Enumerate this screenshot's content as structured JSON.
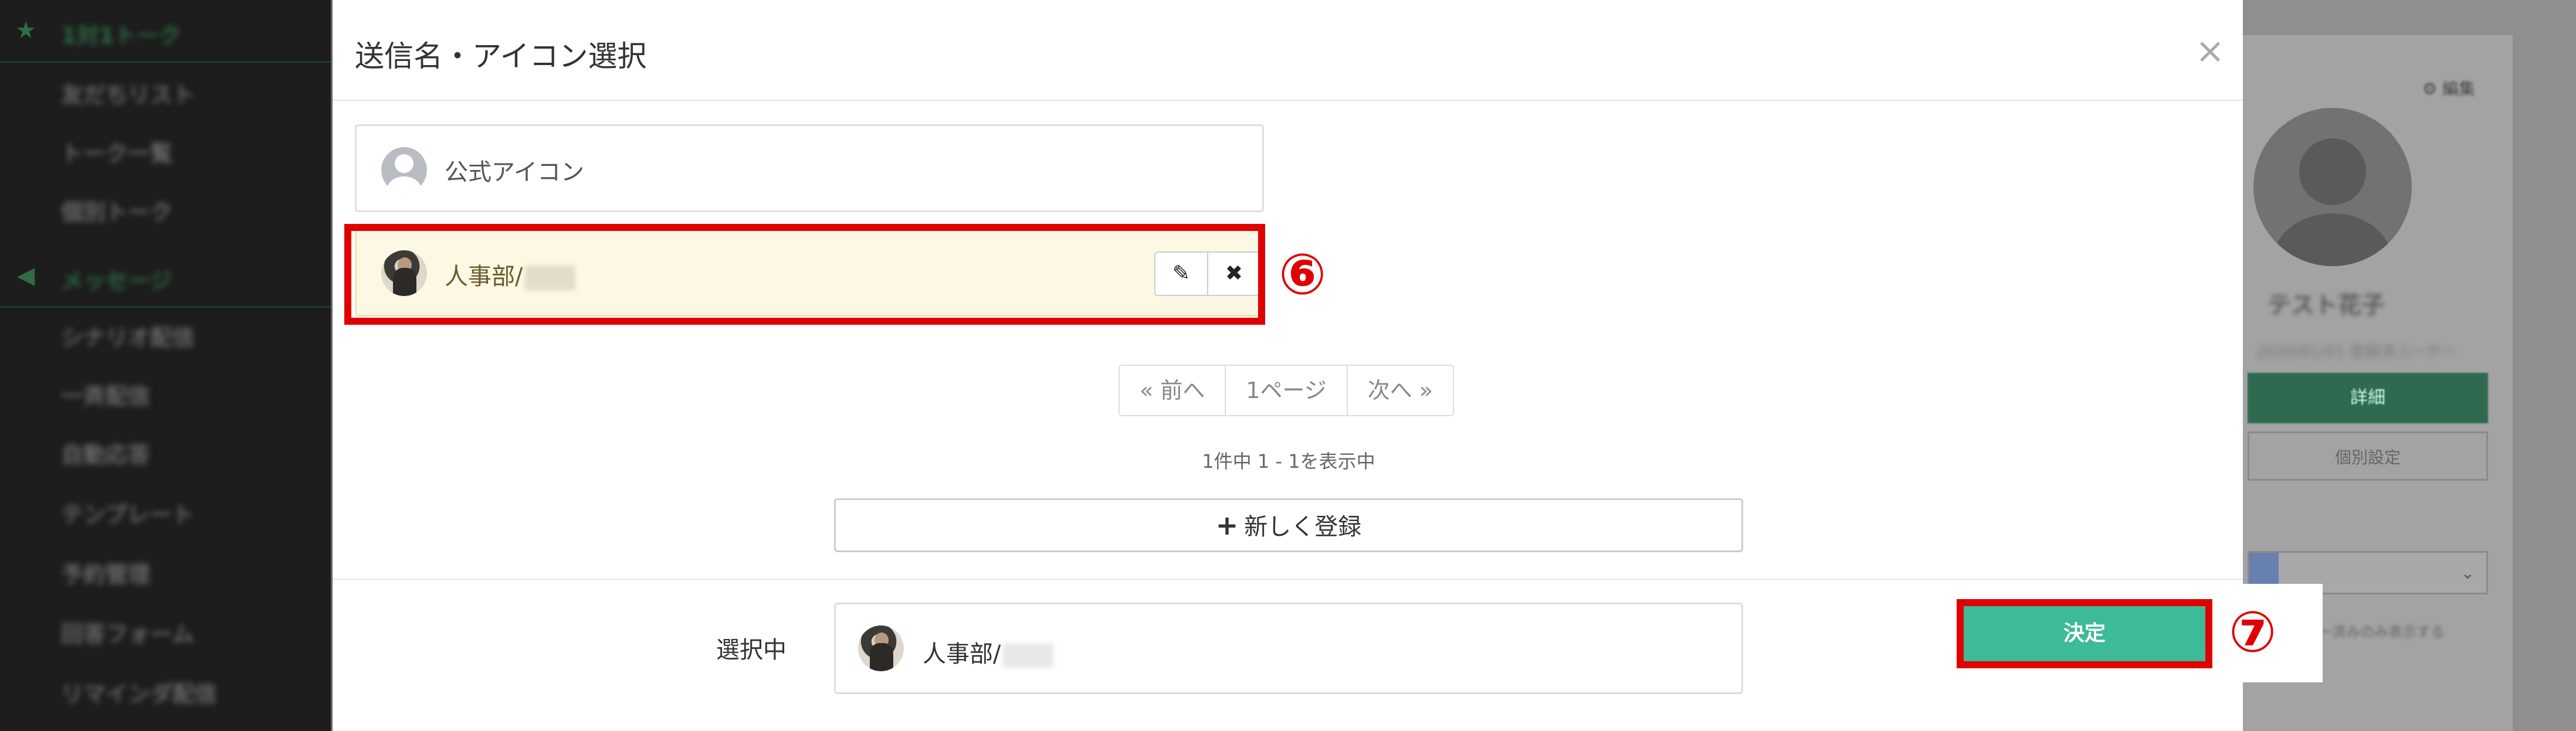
{
  "background": {
    "sidebar": {
      "sections": [
        {
          "icon": "star-icon",
          "label": "1対1トーク"
        },
        {
          "icon": "megaphone-icon",
          "label": "メッセージ"
        }
      ],
      "talk_items": [
        "友だちリスト",
        "トーク一覧",
        "個別トーク"
      ],
      "message_items": [
        "シナリオ配信",
        "一斉配信",
        "自動応答",
        "テンプレート",
        "予約管理",
        "回答フォーム",
        "リマインダ配信"
      ]
    },
    "right_panel": {
      "edit_link": "⚙ 編集",
      "name": "テスト花子",
      "sub": "2020/01/01 登録済ユーザー",
      "green_button": "詳細",
      "outline_button": "個別設定",
      "select_note": "フォロー済みのみ表示する"
    }
  },
  "modal": {
    "title": "送信名・アイコン選択",
    "close_symbol": "×",
    "rows": [
      {
        "label": "公式アイコン",
        "selected": false,
        "avatar": "default-user"
      },
      {
        "label": "人事部/",
        "selected": true,
        "avatar": "photo"
      }
    ],
    "edit_icon": "✎",
    "delete_icon": "✖",
    "pagination": [
      "« 前へ",
      "1ページ",
      "次へ »"
    ],
    "count_text": "1件中 1 - 1を表示中",
    "new_button": {
      "plus": "+",
      "label": "新しく登録"
    },
    "selected_label": "選択中",
    "selected_value": "人事部/",
    "decide_button": "決定"
  },
  "annotations": {
    "step6": "⑥",
    "step7": "⑦",
    "highlight_color": "#e00000"
  },
  "colors": {
    "accent_green": "#3dba98",
    "selected_row_bg": "#fcf8e3",
    "sidebar_bg": "#1c1d1c"
  }
}
